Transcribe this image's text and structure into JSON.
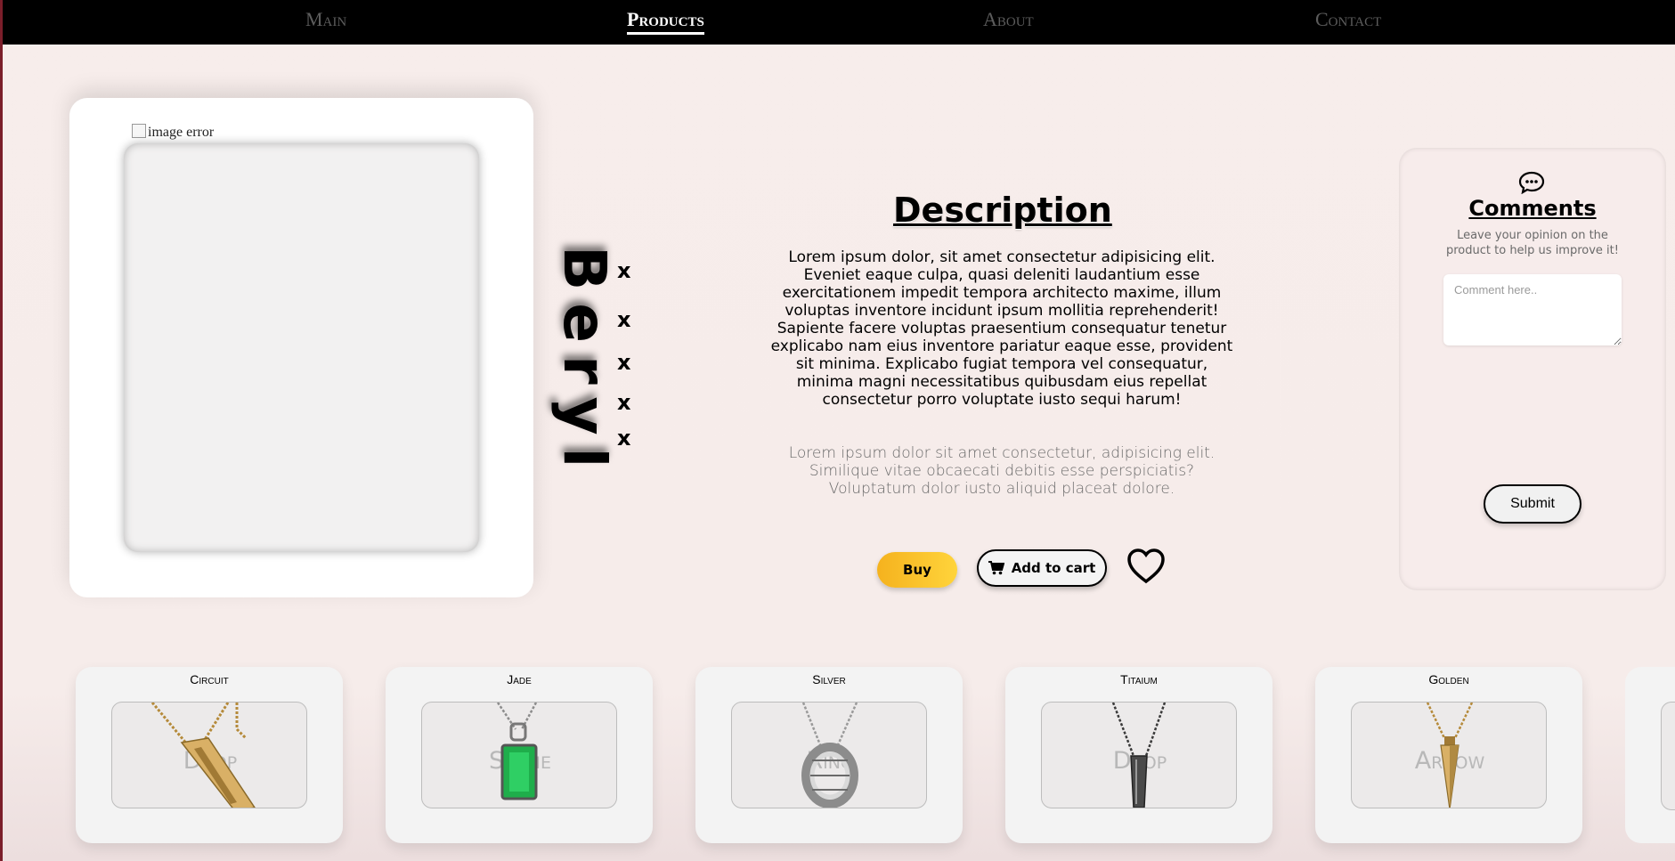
{
  "nav": {
    "items": [
      {
        "label": "Main",
        "active": false
      },
      {
        "label": "Products",
        "active": true
      },
      {
        "label": "About",
        "active": false
      },
      {
        "label": "Contact",
        "active": false
      }
    ]
  },
  "product": {
    "image_alt": "image error",
    "name": "Beryl",
    "x_marks": [
      "x",
      "x",
      "x",
      "x",
      "x"
    ]
  },
  "description": {
    "title": "Description",
    "paragraph1": "Lorem ipsum dolor, sit amet consectetur adipisicing elit. Eveniet eaque culpa, quasi deleniti laudantium esse exercitationem impedit tempora architecto maxime, illum voluptas inventore incidunt ipsum mollitia reprehenderit! Sapiente facere voluptas praesentium consequatur tenetur explicabo nam eius inventore pariatur eaque esse, provident sit minima. Explicabo fugiat tempora vel consequatur, minima magni necessitatibus quibusdam eius repellat consectetur porro voluptate iusto sequi harum!",
    "paragraph2": "Lorem ipsum dolor sit amet consectetur, adipisicing elit. Similique vitae obcaecati debitis esse perspiciatis? Voluptatum dolor iusto aliquid placeat dolore."
  },
  "actions": {
    "buy_label": "Buy",
    "cart_label": "Add to cart",
    "cart_icon": "cart-icon",
    "favorite_icon": "heart-icon"
  },
  "comments": {
    "icon": "chat-icon",
    "title": "Comments",
    "subtitle": "Leave your opinion on the product to help us improve it!",
    "placeholder": "Comment here..",
    "submit_label": "Submit"
  },
  "cards": [
    {
      "name": "Circuit",
      "caption": "Drop",
      "metal": "gold"
    },
    {
      "name": "Jade",
      "caption": "Stone",
      "metal": "silver"
    },
    {
      "name": "Silver",
      "caption": "Ring",
      "metal": "silver"
    },
    {
      "name": "Titaium",
      "caption": "Drop",
      "metal": "dark"
    },
    {
      "name": "Golden",
      "caption": "Arrow",
      "metal": "gold"
    }
  ],
  "colors": {
    "nav_bg": "#000000",
    "page_bg": "#f7edeb",
    "buy_gradient_start": "#f5b21e",
    "buy_gradient_end": "#ffd43b",
    "jade_green": "#1fae4b"
  }
}
